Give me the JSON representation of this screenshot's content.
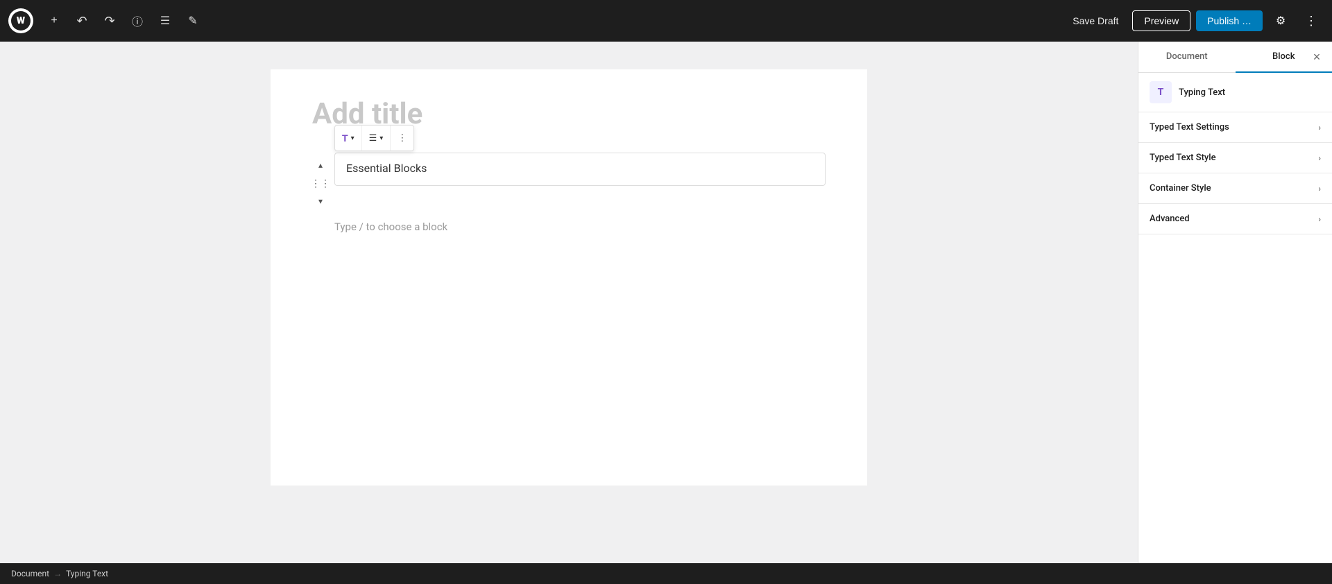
{
  "topbar": {
    "logo_label": "W",
    "add_button_title": "Add new block",
    "undo_title": "Undo",
    "redo_title": "Redo",
    "info_title": "View post details",
    "list_view_title": "List View",
    "tools_title": "Tools",
    "save_draft_label": "Save Draft",
    "preview_label": "Preview",
    "publish_label": "Publish …",
    "settings_title": "Settings",
    "more_title": "Options"
  },
  "editor": {
    "title_placeholder": "Add title",
    "prefix_placeholder": "Type / to choose a block",
    "block_content": "Essential Blocks"
  },
  "sidebar": {
    "tabs": [
      {
        "id": "document",
        "label": "Document"
      },
      {
        "id": "block",
        "label": "Block"
      }
    ],
    "active_tab": "block",
    "close_title": "Close Settings",
    "block_name": "Typing Text",
    "block_icon": "T",
    "sections": [
      {
        "id": "typed-text-settings",
        "label": "Typed Text Settings",
        "expanded": false
      },
      {
        "id": "typed-text-style",
        "label": "Typed Text Style",
        "expanded": false
      },
      {
        "id": "container-style",
        "label": "Container Style",
        "expanded": false
      },
      {
        "id": "advanced",
        "label": "Advanced",
        "expanded": false
      }
    ]
  },
  "breadcrumb": {
    "items": [
      {
        "id": "document",
        "label": "Document"
      },
      {
        "id": "typing-text",
        "label": "Typing Text"
      }
    ],
    "separator": "→"
  },
  "icons": {
    "add": "+",
    "undo": "↶",
    "redo": "↷",
    "info": "ⓘ",
    "list_view": "☰",
    "tools": "✎",
    "settings": "⚙",
    "more": "⋮",
    "close": "×",
    "chevron_down": "›",
    "chevron_up": "‹",
    "block_type": "T",
    "align": "☰",
    "block_more": "⋮",
    "move_up": "▴",
    "drag": "⎕",
    "move_down": "▾"
  },
  "colors": {
    "topbar_bg": "#1e1e1e",
    "publish_bg": "#007cba",
    "active_tab_border": "#007cba",
    "block_icon_bg": "#f0f0ff",
    "block_icon_color": "#7b4fc8"
  }
}
